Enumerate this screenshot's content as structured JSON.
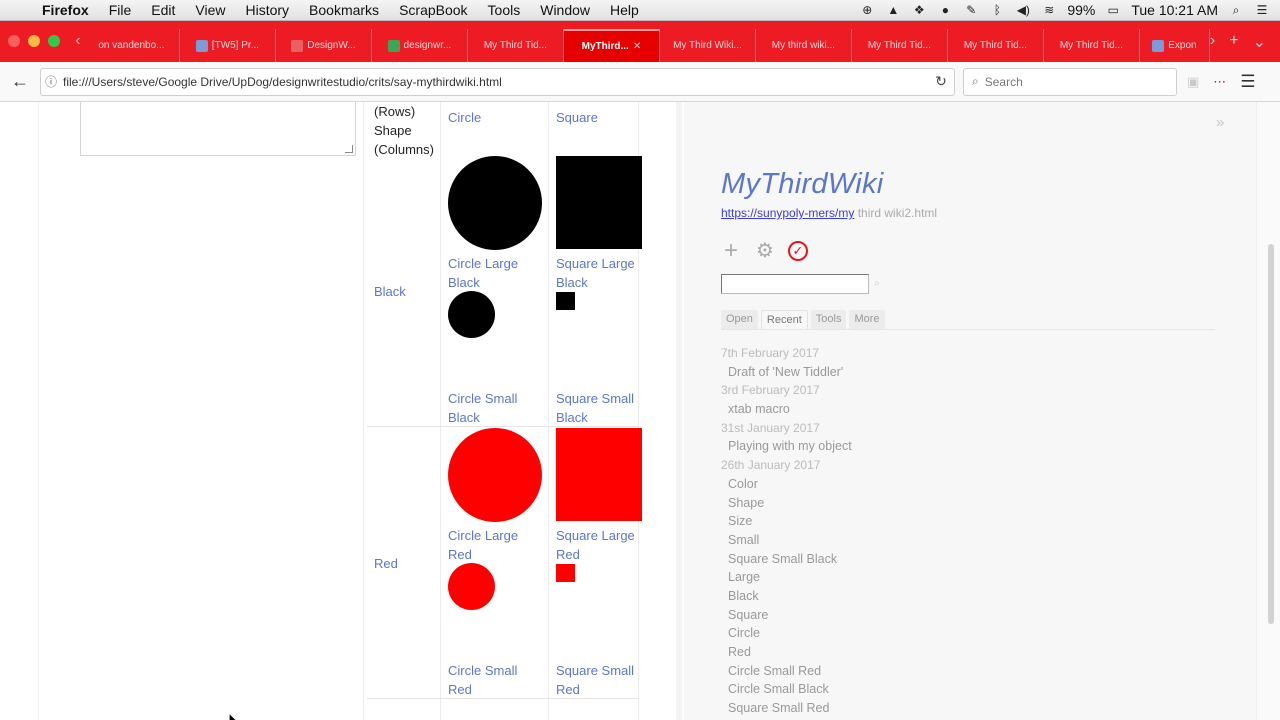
{
  "menubar": {
    "app": "Firefox",
    "items": [
      "File",
      "Edit",
      "View",
      "History",
      "Bookmarks",
      "ScrapBook",
      "Tools",
      "Window",
      "Help"
    ],
    "battery": "99%",
    "clock": "Tue 10:21 AM"
  },
  "tabs": [
    {
      "label": "on vandenbo...",
      "active": false
    },
    {
      "label": "[TW5] Pr...",
      "active": false
    },
    {
      "label": "DesignW...",
      "active": false
    },
    {
      "label": "designwr...",
      "active": false
    },
    {
      "label": "My Third Tid...",
      "active": false
    },
    {
      "label": "MyThird...",
      "active": true
    },
    {
      "label": "My Third Wiki...",
      "active": false
    },
    {
      "label": "My third wiki...",
      "active": false
    },
    {
      "label": "My Third Tid...",
      "active": false
    },
    {
      "label": "My Third Tid...",
      "active": false
    },
    {
      "label": "My Third Tid...",
      "active": false
    },
    {
      "label": "Expon",
      "active": false
    }
  ],
  "navbar": {
    "url": "file:///Users/steve/Google Drive/UpDog/designwritestudio/crits/say-mythirdwiki.html",
    "search_placeholder": "Search"
  },
  "xtab": {
    "header_label": "(Rows) Shape (Columns)",
    "columns": [
      "Circle",
      "Square"
    ],
    "rows": [
      {
        "label": "Black",
        "color": "#000000",
        "cells": {
          "circle_large": "Circle Large Black",
          "square_large": "Square Large Black",
          "circle_small": "Circle Small Black",
          "square_small": "Square Small Black"
        }
      },
      {
        "label": "Red",
        "color": "#ff0000",
        "cells": {
          "circle_large": "Circle Large Red",
          "square_large": "Square Large Red",
          "circle_small": "Circle Small Red",
          "square_small": "Square Small Red"
        }
      }
    ]
  },
  "sidebar": {
    "title": "MyThirdWiki",
    "subtitle_link": "https://sunypoly-mers/my",
    "subtitle_rest": " third wiki2.html",
    "tabs": [
      "Open",
      "Recent",
      "Tools",
      "More"
    ],
    "selected_tab": "Recent",
    "recent": [
      {
        "date": "7th February 2017",
        "items": [
          "Draft of 'New Tiddler'"
        ]
      },
      {
        "date": "3rd February 2017",
        "items": [
          "xtab macro"
        ]
      },
      {
        "date": "31st January 2017",
        "items": [
          "Playing with my object"
        ]
      },
      {
        "date": "26th January 2017",
        "items": [
          "Color",
          "Shape",
          "Size",
          "Small",
          "Square Small Black",
          "Large",
          "Black",
          "Square",
          "Circle",
          "Red",
          "Circle Small Red",
          "Circle Small Black",
          "Square Small Red"
        ]
      }
    ]
  },
  "colors": {
    "tab_strip": "#ed1c24",
    "link": "#5b77c7",
    "accent_red": "#e4151b"
  }
}
